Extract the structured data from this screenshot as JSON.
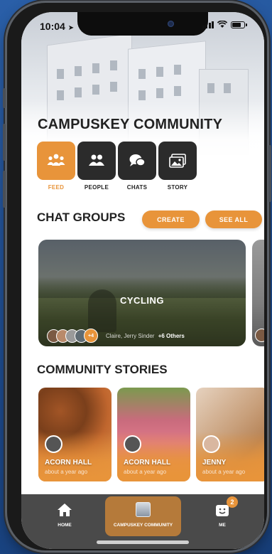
{
  "status_bar": {
    "time": "10:04"
  },
  "header": {
    "title": "CAMPUSKEY COMMUNITY"
  },
  "tabs": [
    {
      "label": "FEED",
      "icon": "people-group-icon",
      "active": true
    },
    {
      "label": "PEOPLE",
      "icon": "people-icon",
      "active": false
    },
    {
      "label": "CHATS",
      "icon": "chat-bubbles-icon",
      "active": false
    },
    {
      "label": "STORY",
      "icon": "photo-gallery-icon",
      "active": false
    }
  ],
  "chat_groups": {
    "title": "CHAT GROUPS",
    "create_label": "CREATE",
    "see_all_label": "SEE ALL",
    "cards": [
      {
        "name": "CYCLING",
        "members_text": "Claire, Jerry Sinder",
        "others_text": "+6 Others",
        "avatar_overflow": "+4"
      }
    ]
  },
  "community_stories": {
    "title": "COMMUNITY STORIES",
    "items": [
      {
        "name": "ACORN HALL",
        "time": "about a year ago"
      },
      {
        "name": "ACORN HALL",
        "time": "about a year ago"
      },
      {
        "name": "JENNY",
        "time": "about a year ago"
      }
    ]
  },
  "tab_bar": {
    "items": [
      {
        "label": "HOME",
        "icon": "home-icon"
      },
      {
        "label": "CAMPUSKEY COMMUNITY",
        "icon": "building-thumbnail-icon",
        "active": true
      },
      {
        "label": "ME",
        "icon": "smiley-icon",
        "badge": "2"
      }
    ]
  },
  "colors": {
    "accent": "#e8943a",
    "dark_tile": "#2b2b2b",
    "tab_bar": "#4a4a4a"
  }
}
